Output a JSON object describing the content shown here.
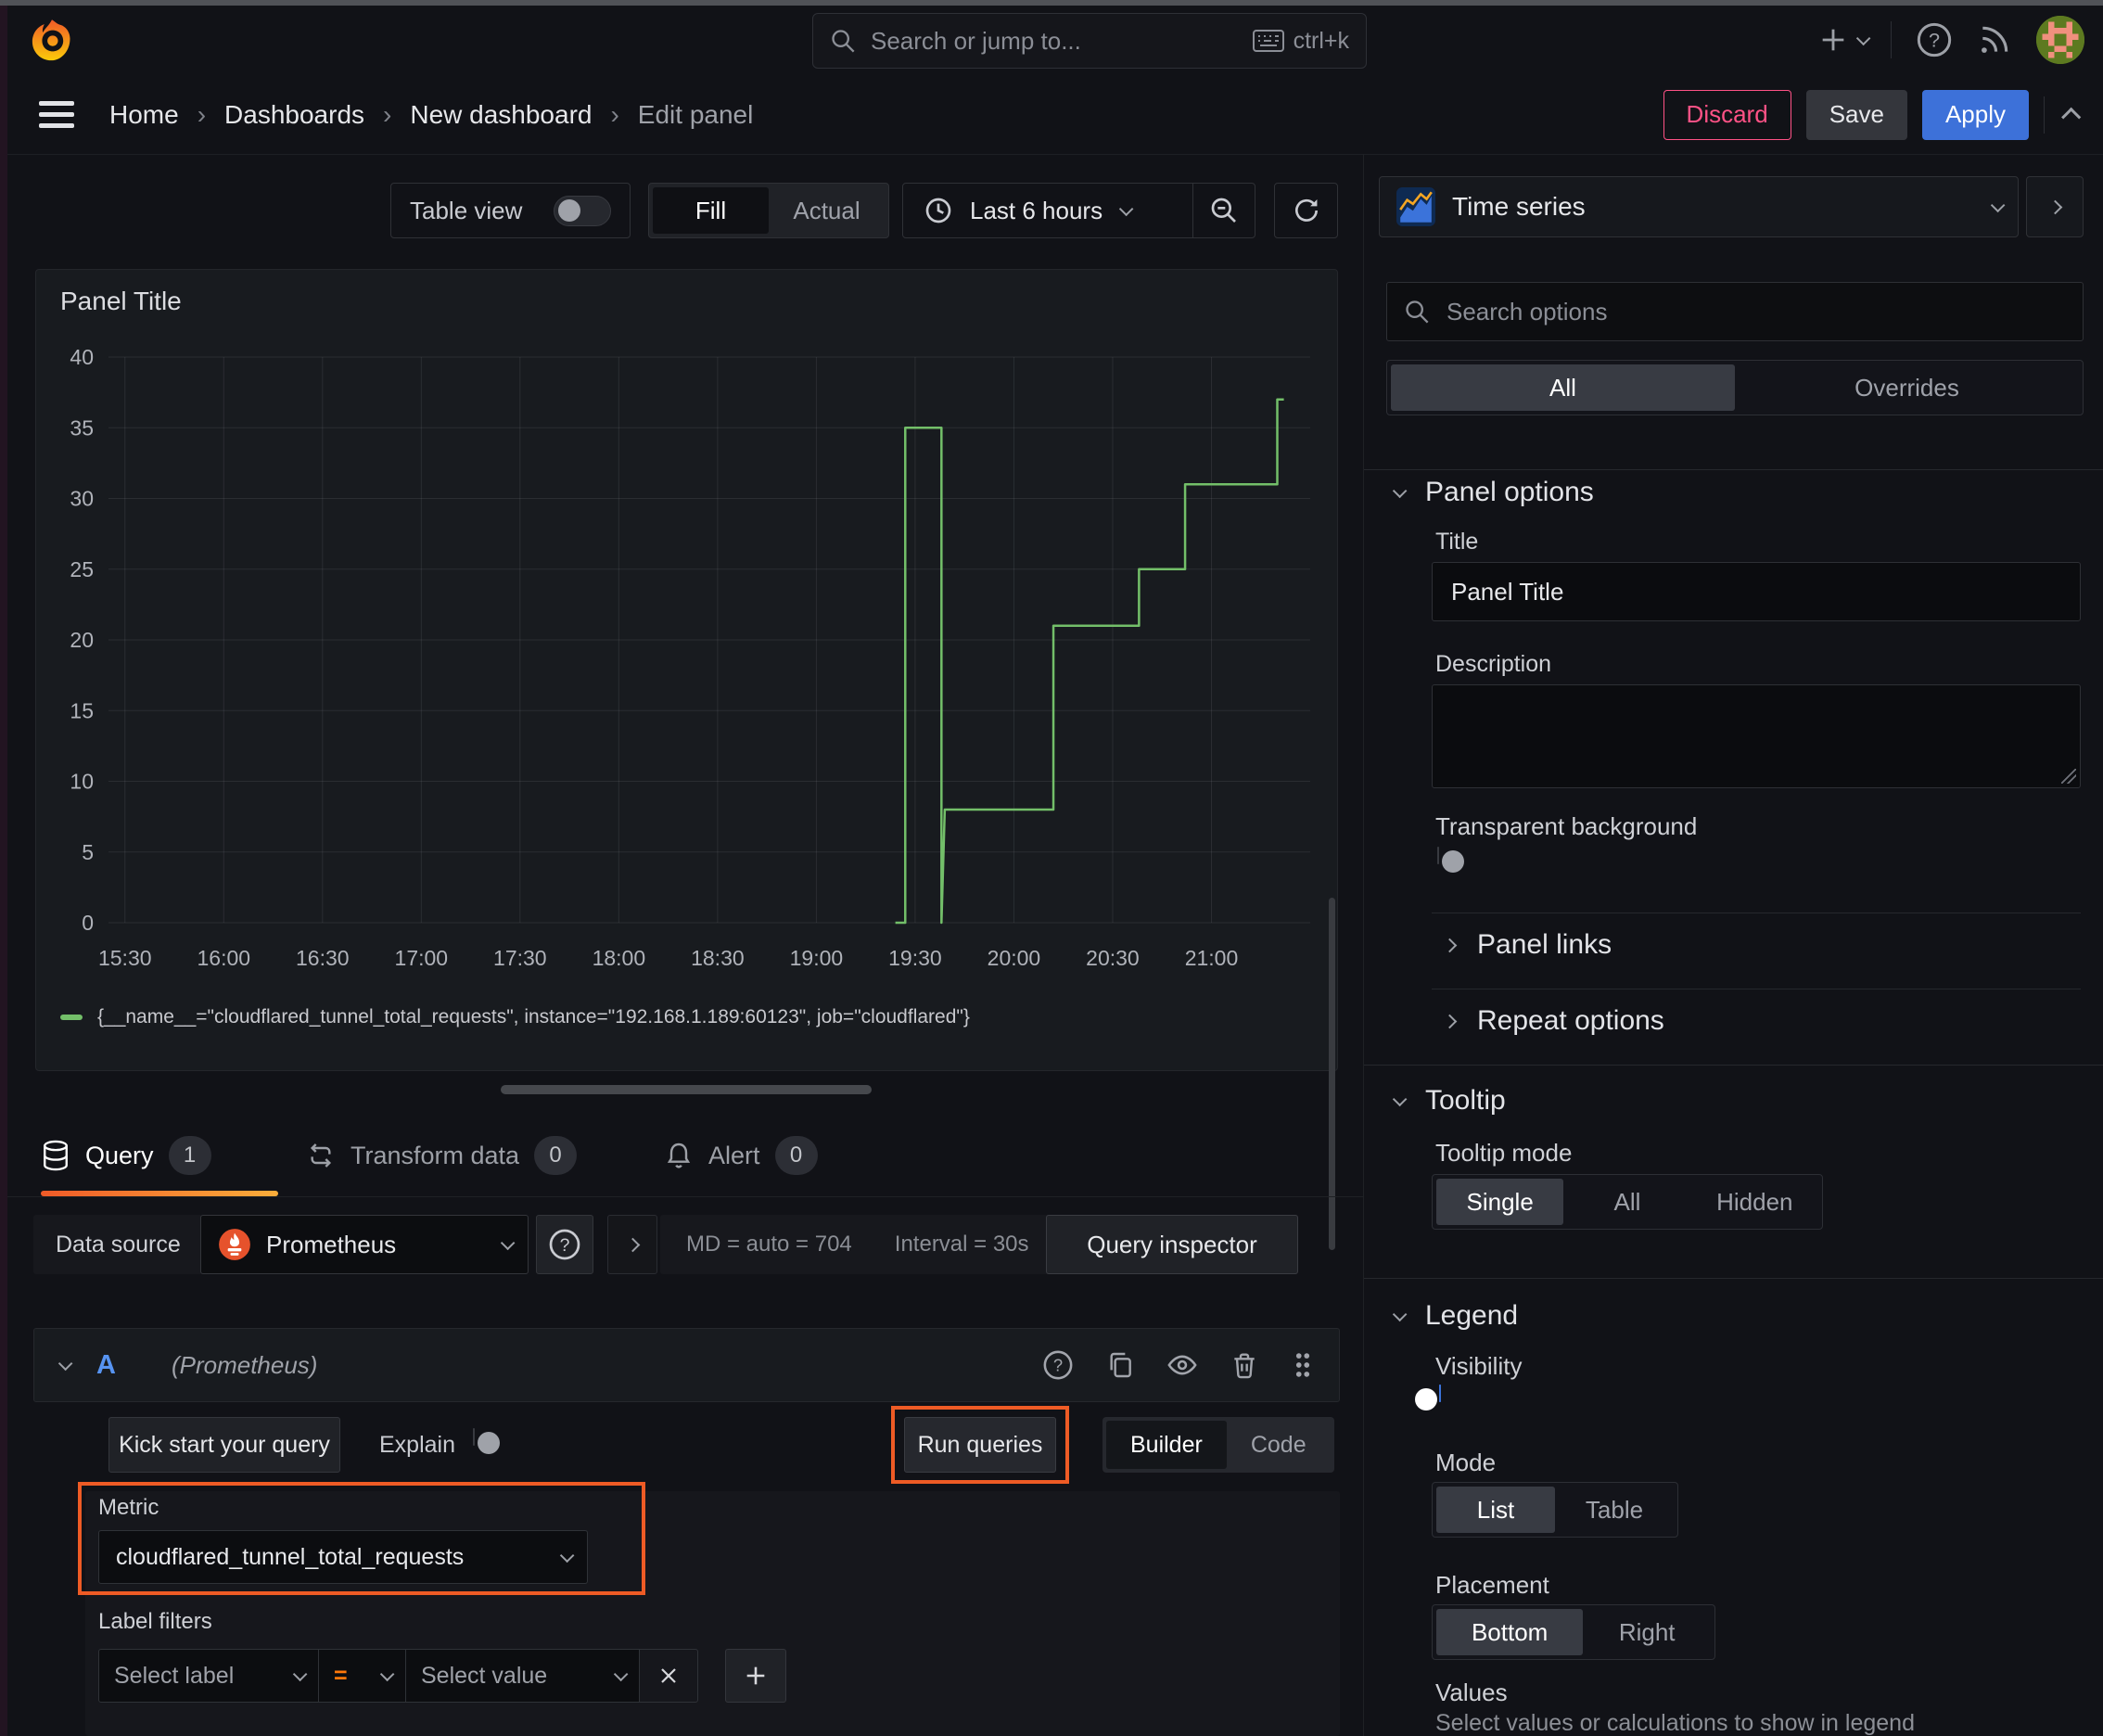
{
  "topbar": {
    "search_placeholder": "Search or jump to...",
    "shortcut": "ctrl+k"
  },
  "breadcrumb": {
    "separator": "›",
    "items": [
      "Home",
      "Dashboards",
      "New dashboard",
      "Edit panel"
    ]
  },
  "header_actions": {
    "discard": "Discard",
    "save": "Save",
    "apply": "Apply"
  },
  "panel_toolbar": {
    "table_view": "Table view",
    "modes": [
      "Fill",
      "Actual"
    ],
    "active_mode": "Fill",
    "time_range": "Last 6 hours"
  },
  "viz_picker": {
    "label": "Time series"
  },
  "panel": {
    "title": "Panel Title"
  },
  "chart_data": {
    "type": "line",
    "title": "Panel Title",
    "xlabel": "",
    "ylabel": "",
    "ylim": [
      0,
      40
    ],
    "y_ticks": [
      0,
      5,
      10,
      15,
      20,
      25,
      30,
      35,
      40
    ],
    "x_domain_minutes": [
      25,
      390
    ],
    "x_ticks": [
      {
        "minutes": 30,
        "label": "15:30"
      },
      {
        "minutes": 60,
        "label": "16:00"
      },
      {
        "minutes": 90,
        "label": "16:30"
      },
      {
        "minutes": 120,
        "label": "17:00"
      },
      {
        "minutes": 150,
        "label": "17:30"
      },
      {
        "minutes": 180,
        "label": "18:00"
      },
      {
        "minutes": 210,
        "label": "18:30"
      },
      {
        "minutes": 240,
        "label": "19:00"
      },
      {
        "minutes": 270,
        "label": "19:30"
      },
      {
        "minutes": 300,
        "label": "20:00"
      },
      {
        "minutes": 330,
        "label": "20:30"
      },
      {
        "minutes": 360,
        "label": "21:00"
      }
    ],
    "grid": true,
    "legend_position": "bottom",
    "series": [
      {
        "name": "{__name__=\"cloudflared_tunnel_total_requests\", instance=\"192.168.1.189:60123\", job=\"cloudflared\"}",
        "color": "#73bf69",
        "points": [
          [
            264,
            0
          ],
          [
            267,
            0
          ],
          [
            267,
            35
          ],
          [
            278,
            35
          ],
          [
            278,
            0
          ],
          [
            279,
            8
          ],
          [
            312,
            8
          ],
          [
            312,
            21
          ],
          [
            338,
            21
          ],
          [
            338,
            25
          ],
          [
            352,
            25
          ],
          [
            352,
            31
          ],
          [
            380,
            31
          ],
          [
            380,
            37
          ],
          [
            382,
            37
          ]
        ]
      }
    ]
  },
  "editor_tabs": [
    {
      "label": "Query",
      "badge": "1"
    },
    {
      "label": "Transform data",
      "badge": "0"
    },
    {
      "label": "Alert",
      "badge": "0"
    }
  ],
  "datasource_row": {
    "label": "Data source",
    "value": "Prometheus",
    "stats_md": "MD = auto = 704",
    "stats_interval": "Interval = 30s",
    "inspector": "Query inspector"
  },
  "query_editor": {
    "ref": "A",
    "hint": "(Prometheus)",
    "kick": "Kick start your query",
    "explain": "Explain",
    "run": "Run queries",
    "modes": [
      "Builder",
      "Code"
    ],
    "active_mode": "Builder",
    "metric_label": "Metric",
    "metric_value": "cloudflared_tunnel_total_requests",
    "filters_label": "Label filters",
    "select_label": "Select label",
    "operator": "=",
    "select_value": "Select value"
  },
  "options_pane": {
    "search_placeholder": "Search options",
    "tabs": [
      "All",
      "Overrides"
    ],
    "active_tab": "All",
    "panel_options": {
      "title": "Panel options",
      "title_label": "Title",
      "title_value": "Panel Title",
      "description_label": "Description",
      "transparent_label": "Transparent background"
    },
    "panel_links": {
      "title": "Panel links"
    },
    "repeat_options": {
      "title": "Repeat options"
    },
    "tooltip": {
      "title": "Tooltip",
      "mode_label": "Tooltip mode",
      "modes": [
        "Single",
        "All",
        "Hidden"
      ],
      "active_mode": "Single"
    },
    "legend": {
      "title": "Legend",
      "visibility_label": "Visibility",
      "mode_label": "Mode",
      "modes": [
        "List",
        "Table"
      ],
      "active_mode": "List",
      "placement_label": "Placement",
      "placements": [
        "Bottom",
        "Right"
      ],
      "active_placement": "Bottom",
      "values_label": "Values",
      "values_hint": "Select values or calculations to show in legend"
    }
  },
  "colors": {
    "accent_blue": "#3d71d9",
    "highlight_orange": "#ee5b25",
    "series_green": "#73bf69",
    "discard_pink": "#ff5286",
    "tab_underline_orange": "#ff780a"
  }
}
